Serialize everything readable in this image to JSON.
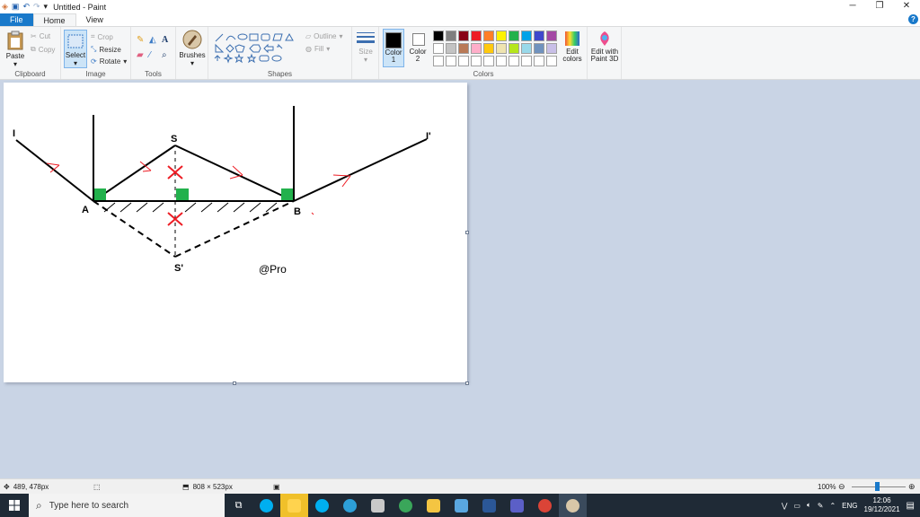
{
  "window": {
    "title": "Untitled - Paint"
  },
  "tabs": [
    {
      "label": "File"
    },
    {
      "label": "Home"
    },
    {
      "label": "View"
    }
  ],
  "ribbon": {
    "clipboard": {
      "label": "Clipboard",
      "paste": "Paste",
      "cut": "Cut",
      "copy": "Copy"
    },
    "image": {
      "label": "Image",
      "select": "Select",
      "crop": "Crop",
      "resize": "Resize",
      "rotate": "Rotate"
    },
    "tools": {
      "label": "Tools"
    },
    "brushes": {
      "label": "Brushes"
    },
    "shapes": {
      "label": "Shapes",
      "outline": "Outline",
      "fill": "Fill"
    },
    "size": {
      "label": "Size"
    },
    "colors": {
      "label": "Colors",
      "color1": "Color 1",
      "color2": "Color 2",
      "edit_colors": "Edit colors",
      "paint3d": "Edit with Paint 3D",
      "color1_value": "#000000",
      "color2_value": "#ffffff",
      "palette_row1": [
        "#000000",
        "#7f7f7f",
        "#880015",
        "#ed1c24",
        "#ff7f27",
        "#fff200",
        "#22b14c",
        "#00a2e8",
        "#3f48cc",
        "#a349a4"
      ],
      "palette_row2": [
        "#ffffff",
        "#c3c3c3",
        "#b97a57",
        "#ffaec9",
        "#ffc90e",
        "#efe4b0",
        "#b5e61d",
        "#99d9ea",
        "#7092be",
        "#c8bfe7"
      ]
    }
  },
  "drawing": {
    "labels": {
      "I": "I",
      "I_prime": "I'",
      "S": "S",
      "S_prime": "S'",
      "A": "A",
      "B": "B"
    },
    "watermark": "@Pro"
  },
  "status": {
    "cursor": "489, 478px",
    "image_size": "808 × 523px",
    "zoom": "100%"
  },
  "taskbar": {
    "search_placeholder": "Type here to search",
    "language": "ENG",
    "time": "12:06",
    "date": "19/12/2021"
  }
}
